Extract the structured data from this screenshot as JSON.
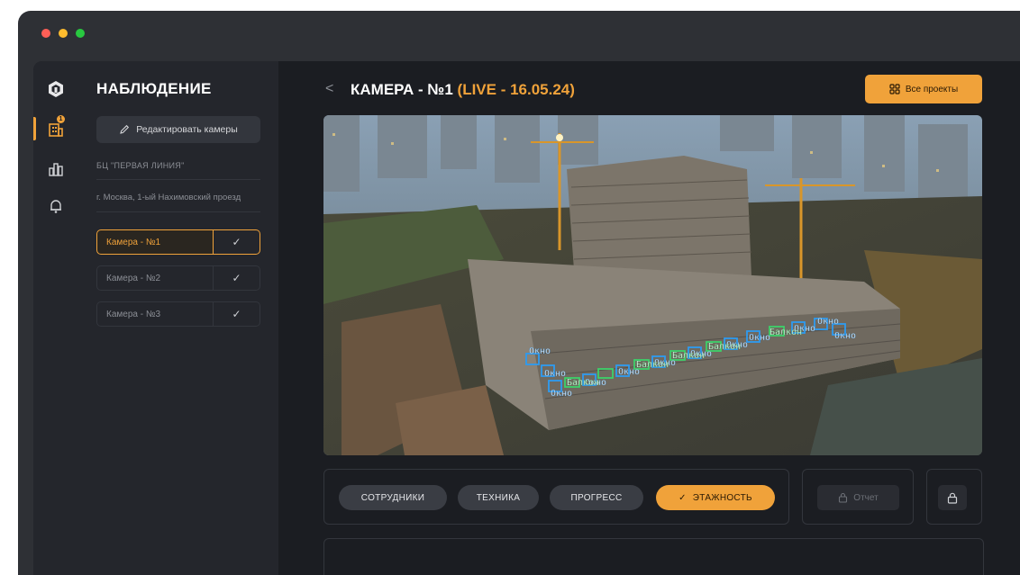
{
  "window": {
    "dots": [
      "#ff5f57",
      "#febc2e",
      "#28c840"
    ]
  },
  "colors": {
    "accent": "#f0a23a",
    "detect_window": "#2d9bf0",
    "detect_balcony": "#3dd16a"
  },
  "rail": {
    "icons": [
      "logo-icon",
      "building-icon",
      "chart-icon",
      "bell-icon"
    ],
    "badge": "1"
  },
  "sidebar": {
    "title": "НАБЛЮДЕНИЕ",
    "edit_button": "Редактировать камеры",
    "project": "БЦ \"ПЕРВАЯ ЛИНИЯ\"",
    "address": "г. Москва, 1-ый Нахимовский проезд",
    "cameras": [
      {
        "name": "Камера - №1",
        "active": true
      },
      {
        "name": "Камера - №2",
        "active": false
      },
      {
        "name": "Камера - №3",
        "active": false
      }
    ]
  },
  "header": {
    "back": "<",
    "title": "КАМЕРА - №1",
    "live": "(LIVE - 16.05.24)",
    "all_projects": "Все проекты"
  },
  "detections": {
    "window_label": "Окно",
    "balcony_label": "Балкон"
  },
  "tabs": [
    {
      "label": "СОТРУДНИКИ",
      "active": false
    },
    {
      "label": "ТЕХНИКА",
      "active": false
    },
    {
      "label": "ПРОГРЕСС",
      "active": false
    },
    {
      "label": "ЭТАЖНОСТЬ",
      "active": true
    }
  ],
  "report_button": "Отчет"
}
